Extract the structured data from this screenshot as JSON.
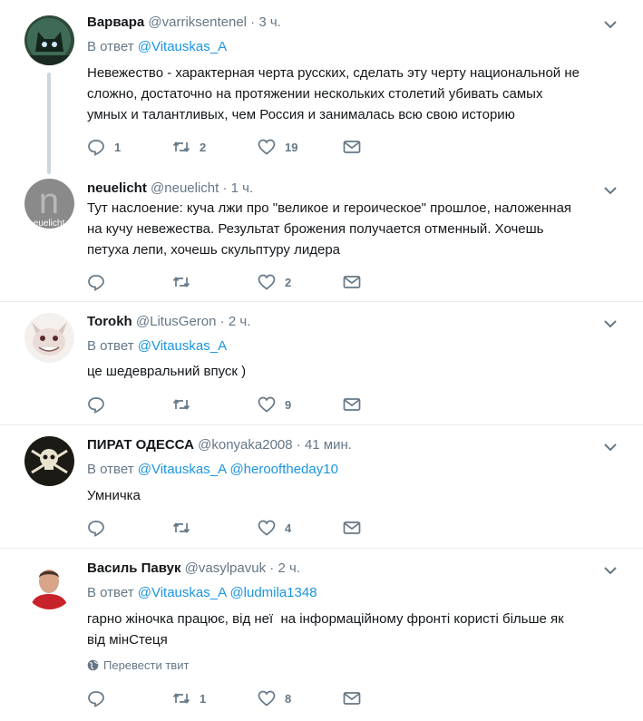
{
  "colors": {
    "link": "#1b95e0",
    "secondary_text": "#657786",
    "primary_text": "#14171a",
    "divider": "#e6ecf0",
    "thread_line": "#ccd6dd"
  },
  "tweets": [
    {
      "name": "Варвара",
      "handle": "@varriksentenel",
      "dot": "·",
      "time": "3 ч.",
      "reply_prefix": "В ответ",
      "mentions": [
        "@Vitauskas_A"
      ],
      "text": "Невежество - характерная черта русских, сделать эту черту национальной не\nсложно, достаточно на протяжении нескольких столетий убивать самых\nумных и талантливых, чем Россия и занималась всю свою историю",
      "reply_count": "1",
      "retweet_count": "2",
      "like_count": "19",
      "avatar_icon": "cat-avatar"
    },
    {
      "name": "neuelicht",
      "handle": "@neuelicht",
      "dot": "·",
      "time": "1 ч.",
      "text": "Тут наслоение: куча лжи про \"великое и героическое\" прошлое, наложенная\nна кучу невежества. Результат брожения получается отменный. Хочешь\nпетуха лепи, хочешь скульптуру лидера",
      "reply_count": "",
      "retweet_count": "",
      "like_count": "2",
      "avatar_letter": "n",
      "avatar_caption": "euelicht"
    },
    {
      "name": "Torokh",
      "handle": "@LitusGeron",
      "dot": "·",
      "time": "2 ч.",
      "reply_prefix": "В ответ",
      "mentions": [
        "@Vitauskas_A"
      ],
      "text": "це шедевральний впуск )",
      "reply_count": "",
      "retweet_count": "",
      "like_count": "9",
      "avatar_icon": "creature-avatar"
    },
    {
      "name": "ПИРАТ ОДЕССА",
      "handle": "@konyaka2008",
      "dot": "·",
      "time": "41 мин.",
      "reply_prefix": "В ответ",
      "mentions": [
        "@Vitauskas_A",
        "@herooftheday10"
      ],
      "text": "Умничка",
      "reply_count": "",
      "retweet_count": "",
      "like_count": "4",
      "avatar_icon": "skull-crossbones-avatar"
    },
    {
      "name": "Василь Павук",
      "handle": "@vasylpavuk",
      "dot": "·",
      "time": "2 ч.",
      "reply_prefix": "В ответ",
      "mentions": [
        "@Vitauskas_A",
        "@ludmila1348"
      ],
      "text": "гарно жіночка працює, від неї  на інформаційному фронті користі більше як\nвід мінСтеця",
      "translate_label": "Перевести твит",
      "reply_count": "",
      "retweet_count": "1",
      "like_count": "8",
      "avatar_icon": "person-photo-avatar"
    }
  ]
}
